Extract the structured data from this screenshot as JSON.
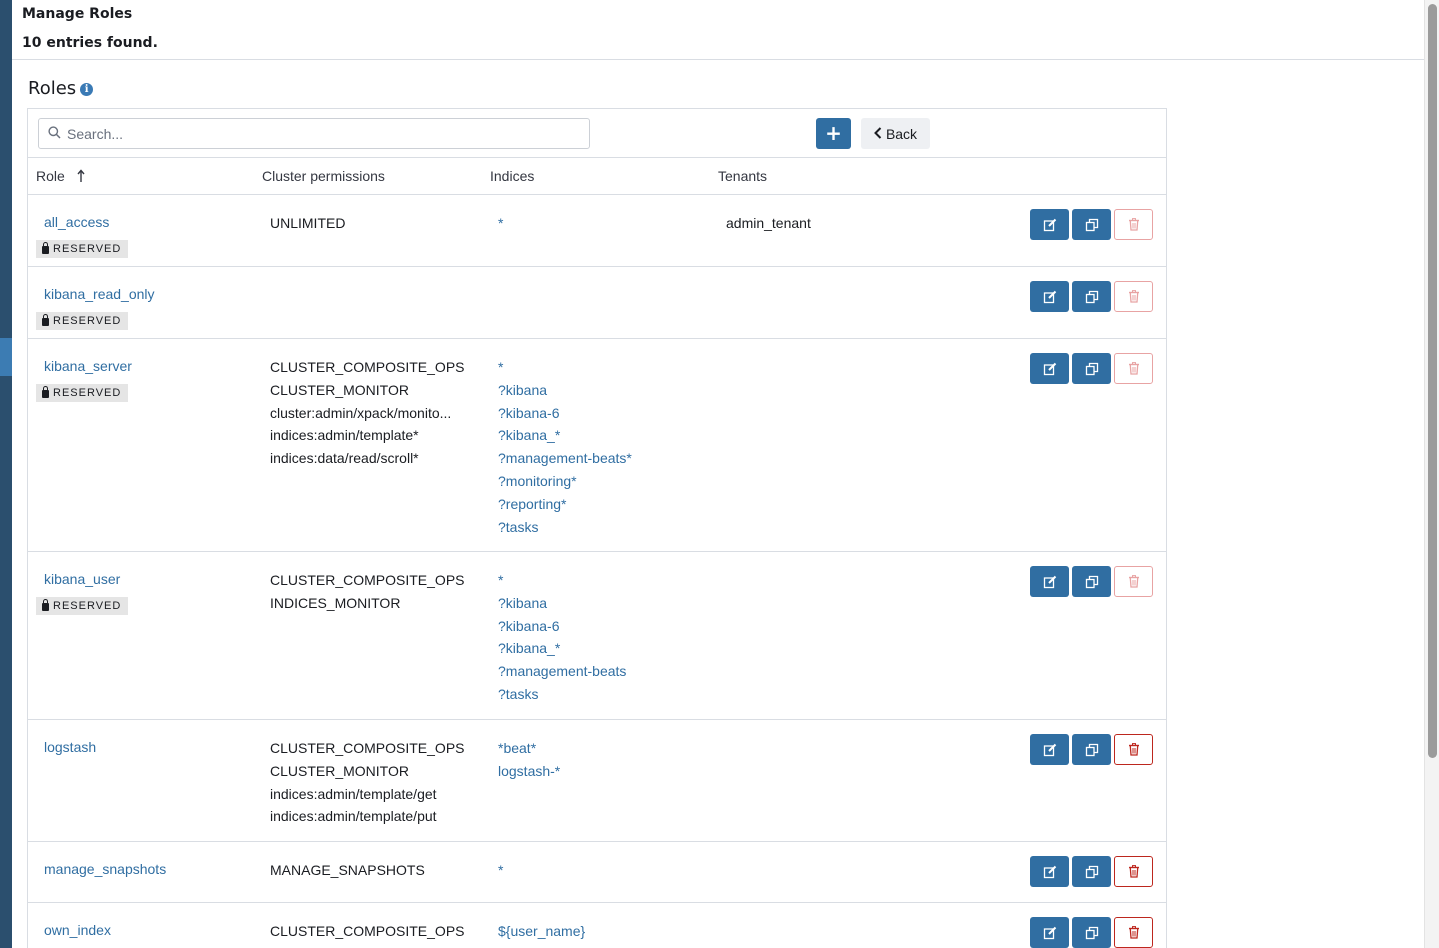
{
  "header": {
    "title": "Manage Roles",
    "count": "10 entries found."
  },
  "section": {
    "title": "Roles"
  },
  "toolbar": {
    "search_placeholder": "Search...",
    "back_label": "Back"
  },
  "columns": {
    "role": "Role",
    "cluster": "Cluster permissions",
    "indices": "Indices",
    "tenants": "Tenants"
  },
  "reserved_label": "RESERVED",
  "colors": {
    "primary": "#306ea2",
    "danger": "#bd271e",
    "rail": "#2b4f6e"
  },
  "roles": [
    {
      "name": "all_access",
      "reserved": true,
      "cluster": [
        "UNLIMITED"
      ],
      "indices": [
        "*"
      ],
      "tenants": [
        "admin_tenant"
      ]
    },
    {
      "name": "kibana_read_only",
      "reserved": true,
      "cluster": [],
      "indices": [],
      "tenants": []
    },
    {
      "name": "kibana_server",
      "reserved": true,
      "cluster": [
        "CLUSTER_COMPOSITE_OPS",
        "CLUSTER_MONITOR",
        "cluster:admin/xpack/monito...",
        "indices:admin/template*",
        "indices:data/read/scroll*"
      ],
      "indices": [
        "*",
        "?kibana",
        "?kibana-6",
        "?kibana_*",
        "?management-beats*",
        "?monitoring*",
        "?reporting*",
        "?tasks"
      ],
      "tenants": []
    },
    {
      "name": "kibana_user",
      "reserved": true,
      "cluster": [
        "CLUSTER_COMPOSITE_OPS",
        "INDICES_MONITOR"
      ],
      "indices": [
        "*",
        "?kibana",
        "?kibana-6",
        "?kibana_*",
        "?management-beats",
        "?tasks"
      ],
      "tenants": []
    },
    {
      "name": "logstash",
      "reserved": false,
      "cluster": [
        "CLUSTER_COMPOSITE_OPS",
        "CLUSTER_MONITOR",
        "indices:admin/template/get",
        "indices:admin/template/put"
      ],
      "indices": [
        "*beat*",
        "logstash-*"
      ],
      "tenants": []
    },
    {
      "name": "manage_snapshots",
      "reserved": false,
      "cluster": [
        "MANAGE_SNAPSHOTS"
      ],
      "indices": [
        "*"
      ],
      "tenants": []
    },
    {
      "name": "own_index",
      "reserved": false,
      "cluster": [
        "CLUSTER_COMPOSITE_OPS"
      ],
      "indices": [
        "${user_name}"
      ],
      "tenants": []
    }
  ]
}
